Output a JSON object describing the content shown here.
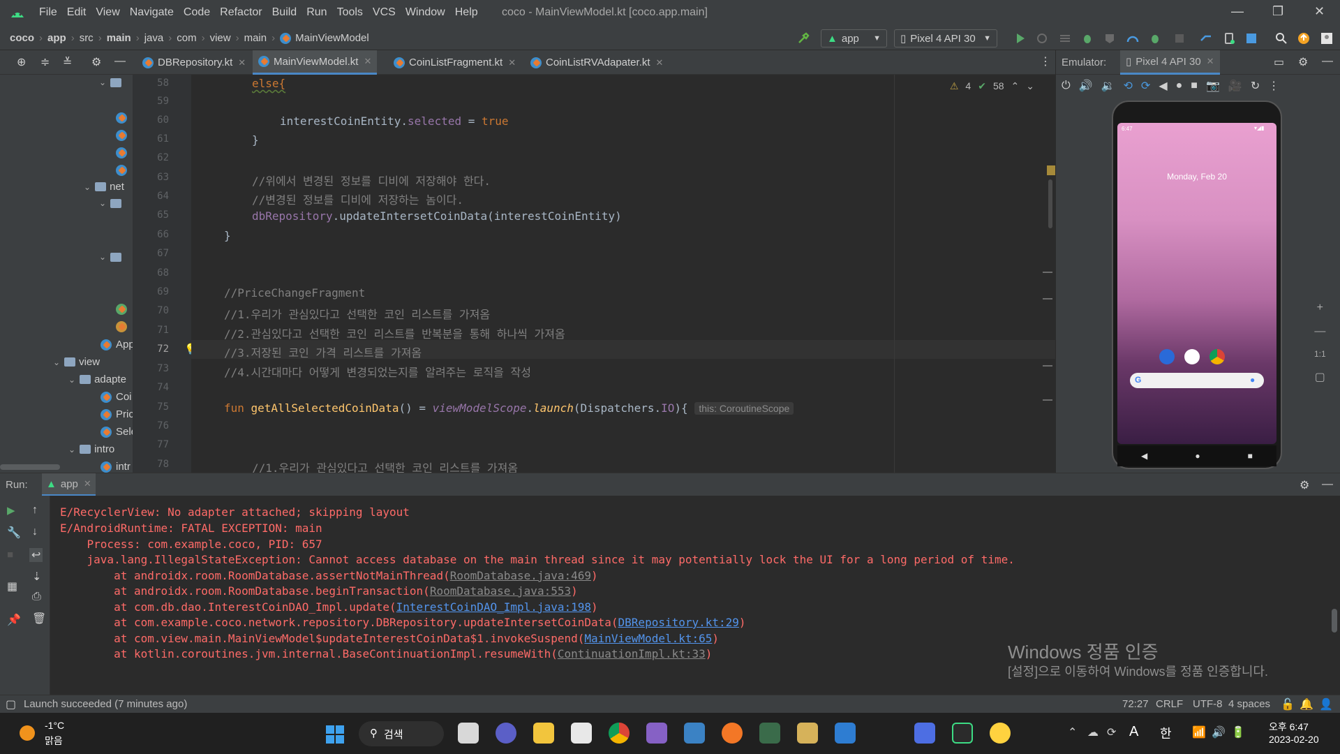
{
  "window": {
    "title": "coco - MainViewModel.kt [coco.app.main]",
    "controls": [
      "—",
      "❐",
      "✕"
    ]
  },
  "menu": [
    "File",
    "Edit",
    "View",
    "Navigate",
    "Code",
    "Refactor",
    "Build",
    "Run",
    "Tools",
    "VCS",
    "Window",
    "Help"
  ],
  "breadcrumbs": [
    "coco",
    "app",
    "src",
    "main",
    "java",
    "com",
    "view",
    "main",
    "MainViewModel"
  ],
  "toolbar": {
    "run_config": "app",
    "device": "Pixel 4 API 30"
  },
  "editor_tabs": [
    {
      "label": "DBRepository.kt",
      "active": false
    },
    {
      "label": "MainViewModel.kt",
      "active": true
    },
    {
      "label": "CoinListFragment.kt",
      "active": false
    },
    {
      "label": "CoinListRVAdapater.kt",
      "active": false
    }
  ],
  "project_tree": {
    "items": [
      "net",
      "App",
      "view",
      "adapte",
      "Coi",
      "Pric",
      "Sele",
      "intro",
      "intr"
    ]
  },
  "inspections": {
    "warnings": "4",
    "ok": "58"
  },
  "code": {
    "line_numbers": [
      "58",
      "59",
      "60",
      "61",
      "62",
      "63",
      "64",
      "65",
      "66",
      "67",
      "68",
      "69",
      "70",
      "71",
      "72",
      "73",
      "74",
      "75",
      "76",
      "77",
      "78"
    ],
    "current_line": "72",
    "l58": "else{",
    "l60_a": "interestCoinEntity.",
    "l60_b": "selected",
    "l60_c": " = ",
    "l60_d": "true",
    "l61": "}",
    "l63": "//위에서 변경된 정보를 디비에 저장해야 한다.",
    "l64": "//변경된 정보를 디비에 저장하는 놈이다.",
    "l65_a": "dbRepository",
    "l65_b": ".updateIntersetCoinData(interestCoinEntity)",
    "l66": "}",
    "l69": "//PriceChangeFragment",
    "l70": "//1.우리가 관심있다고 선택한 코인 리스트를 가져옴",
    "l71": "//2.관심있다고 선택한 코인 리스트를 반복분을 통해 하나씩 가져옴",
    "l72": "//3.저장된 코인 가격 리스트를 가져옴",
    "l73": "//4.시간대마다 어떻게 변경되었는지를 알려주는 로직을 작성",
    "l75_a": "fun ",
    "l75_b": "getAllSelectedCoinData",
    "l75_c": "() = ",
    "l75_d": "viewModelScope",
    "l75_e": ".",
    "l75_f": "launch",
    "l75_g": "(Dispatchers.",
    "l75_h": "IO",
    "l75_i": "){",
    "l75_hint": "this: CoroutineScope",
    "l78": "//1.우리가 관심있다고 선택한 코인 리스트를 가져옴"
  },
  "emulator": {
    "label": "Emulator:",
    "device_tab": "Pixel 4 API 30",
    "status_time": "6:47",
    "date_widget": "Monday, Feb 20",
    "side_controls": [
      "+",
      "—",
      "1:1",
      "▢"
    ]
  },
  "run": {
    "label": "Run:",
    "tab": "app",
    "lines": [
      "E/RecyclerView: No adapter attached; skipping layout",
      "E/AndroidRuntime: FATAL EXCEPTION: main",
      "    Process: com.example.coco, PID: 657",
      "    java.lang.IllegalStateException: Cannot access database on the main thread since it may potentially lock the UI for a long period of time."
    ],
    "stack": [
      {
        "text": "        at androidx.room.RoomDatabase.assertNotMainThread(",
        "link": "RoomDatabase.java:469",
        "end": ")",
        "blue": false
      },
      {
        "text": "        at androidx.room.RoomDatabase.beginTransaction(",
        "link": "RoomDatabase.java:553",
        "end": ")",
        "blue": false
      },
      {
        "text": "        at com.db.dao.InterestCoinDAO_Impl.update(",
        "link": "InterestCoinDAO_Impl.java:198",
        "end": ")",
        "blue": true
      },
      {
        "text": "        at com.example.coco.network.repository.DBRepository.updateIntersetCoinData(",
        "link": "DBRepository.kt:29",
        "end": ")",
        "blue": true
      },
      {
        "text": "        at com.view.main.MainViewModel$updateInterestCoinData$1.invokeSuspend(",
        "link": "MainViewModel.kt:65",
        "end": ")",
        "blue": true
      },
      {
        "text": "        at kotlin.coroutines.jvm.internal.BaseContinuationImpl.resumeWith(",
        "link": "ContinuationImpl.kt:33",
        "end": ")",
        "blue": false
      }
    ],
    "watermark_title": "Windows 정품 인증",
    "watermark_sub": "[설정]으로 이동하여 Windows를 정품 인증합니다."
  },
  "statusbar": {
    "message": "Launch succeeded (7 minutes ago)",
    "position": "72:27",
    "line_sep": "CRLF",
    "encoding": "UTF-8",
    "indent": "4 spaces"
  },
  "taskbar": {
    "weather_temp": "-1°C",
    "weather_desc": "맑음",
    "search": "검색",
    "ime_a": "A",
    "ime_han": "한",
    "time": "오후 6:47",
    "date": "2023-02-20"
  }
}
